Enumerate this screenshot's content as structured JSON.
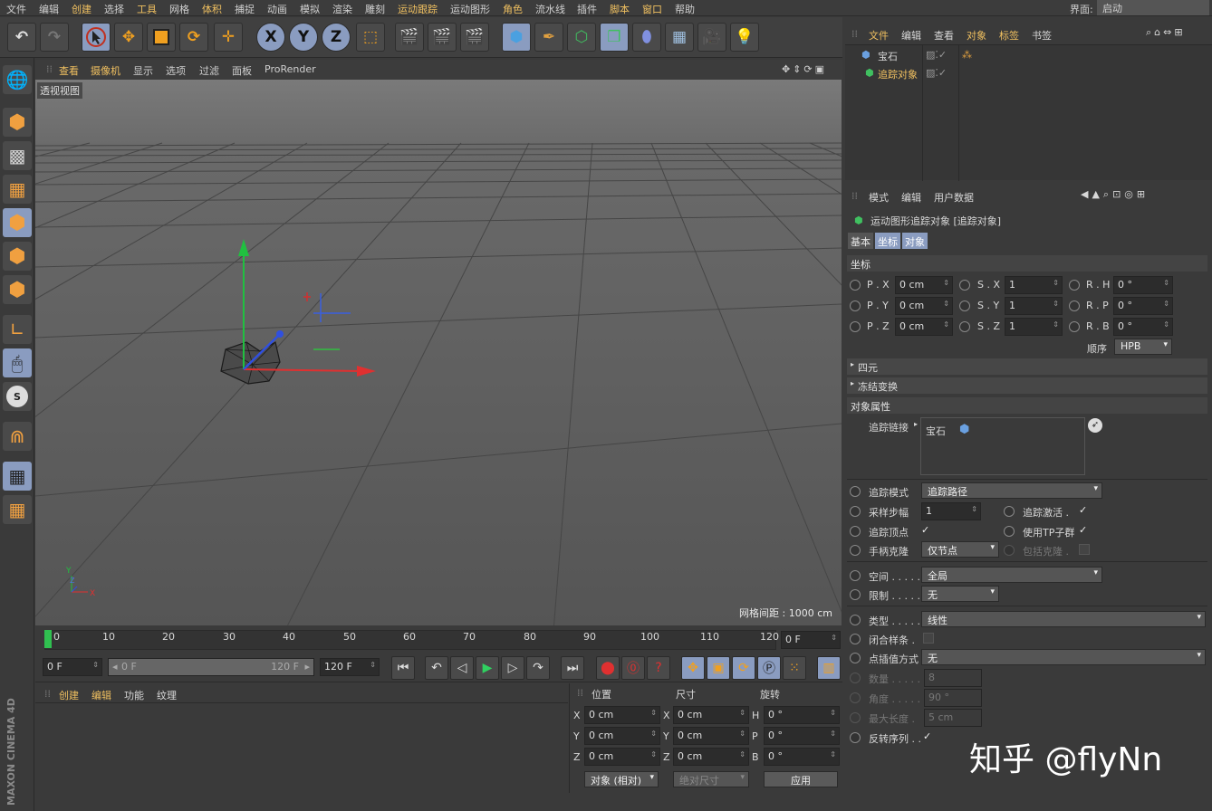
{
  "menubar": {
    "items": [
      "文件",
      "编辑",
      "创建",
      "选择",
      "工具",
      "网格",
      "体积",
      "捕捉",
      "动画",
      "模拟",
      "渲染",
      "雕刻",
      "运动跟踪",
      "运动图形",
      "角色",
      "流水线",
      "插件",
      "脚本",
      "窗口",
      "帮助"
    ],
    "layout_label": "界面:",
    "layout_value": "启动"
  },
  "toolbar": {
    "axis_x": "X",
    "axis_y": "Y",
    "axis_z": "Z"
  },
  "viewport": {
    "menu": [
      "查看",
      "摄像机",
      "显示",
      "选项",
      "过滤",
      "面板",
      "ProRender"
    ],
    "tag": "透视视图",
    "grid_info": "网格间距 : 1000 cm",
    "axis_x": "X",
    "axis_y": "Y",
    "axis_z": "Z"
  },
  "timeline": {
    "ticks": [
      "0",
      "10",
      "20",
      "30",
      "40",
      "50",
      "60",
      "70",
      "80",
      "90",
      "100",
      "110",
      "120"
    ],
    "current_frame_field": "0 F"
  },
  "transport": {
    "start_field": "0 F",
    "range_start": "0 F",
    "range_end": "120 F",
    "end_field": "120 F"
  },
  "material_panel": {
    "menu": [
      "创建",
      "编辑",
      "功能",
      "纹理"
    ]
  },
  "coord_panel": {
    "headers": [
      "位置",
      "尺寸",
      "旋转"
    ],
    "rows": [
      {
        "axis": "X",
        "pos": "0 cm",
        "size_axis": "X",
        "size": "0 cm",
        "rot_axis": "H",
        "rot": "0 °"
      },
      {
        "axis": "Y",
        "pos": "0 cm",
        "size_axis": "Y",
        "size": "0 cm",
        "rot_axis": "P",
        "rot": "0 °"
      },
      {
        "axis": "Z",
        "pos": "0 cm",
        "size_axis": "Z",
        "size": "0 cm",
        "rot_axis": "B",
        "rot": "0 °"
      }
    ],
    "mode_dropdown": "对象 (相对)",
    "size_dropdown": "绝对尺寸",
    "apply_button": "应用"
  },
  "object_manager": {
    "menu": [
      "文件",
      "编辑",
      "查看",
      "对象",
      "标签",
      "书签"
    ],
    "objects": [
      {
        "name": "宝石"
      },
      {
        "name": "追踪对象"
      }
    ]
  },
  "attribute_manager": {
    "menu": [
      "模式",
      "编辑",
      "用户数据"
    ],
    "title": "运动图形追踪对象 [追踪对象]",
    "tabs": [
      "基本",
      "坐标",
      "对象"
    ],
    "section_coord": "坐标",
    "coord_rows": [
      {
        "p_label": "P . X",
        "p_val": "0 cm",
        "s_label": "S . X",
        "s_val": "1",
        "r_label": "R . H",
        "r_val": "0 °"
      },
      {
        "p_label": "P . Y",
        "p_val": "0 cm",
        "s_label": "S . Y",
        "s_val": "1",
        "r_label": "R . P",
        "r_val": "0 °"
      },
      {
        "p_label": "P . Z",
        "p_val": "0 cm",
        "s_label": "S . Z",
        "s_val": "1",
        "r_label": "R . B",
        "r_val": "0 °"
      }
    ],
    "order_label": "顺序",
    "order_value": "HPB",
    "collapse_quat": "四元",
    "collapse_freeze": "冻结变换",
    "section_obj": "对象属性",
    "trace_link_label": "追踪链接",
    "trace_link_value": "宝石",
    "trace_mode_label": "追踪模式",
    "trace_mode_value": "追踪路径",
    "sample_step_label": "采样步幅",
    "sample_step_value": "1",
    "trace_active_label": "追踪激活 .",
    "trace_vertex_label": "追踪顶点",
    "use_tp_label": "使用TP子群",
    "handle_clone_label": "手柄克隆",
    "handle_clone_value": "仅节点",
    "include_clone_label": "包括克隆 .",
    "space_label": "空间 . . . . .",
    "space_value": "全局",
    "limit_label": "限制 . . . . .",
    "limit_value": "无",
    "type_label": "类型 . . . . . .",
    "type_value": "线性",
    "closed_label": "闭合样条 .",
    "interp_label": "点插值方式",
    "interp_value": "无",
    "count_label": "数量 . . . . .",
    "count_value": "8",
    "angle_label": "角度 . . . . .",
    "angle_value": "90 °",
    "maxlen_label": "最大长度 .",
    "maxlen_value": "5 cm",
    "reverse_label": "反转序列 . ."
  },
  "watermark": "知乎 @flyNn",
  "brand": "MAXON CINEMA 4D"
}
